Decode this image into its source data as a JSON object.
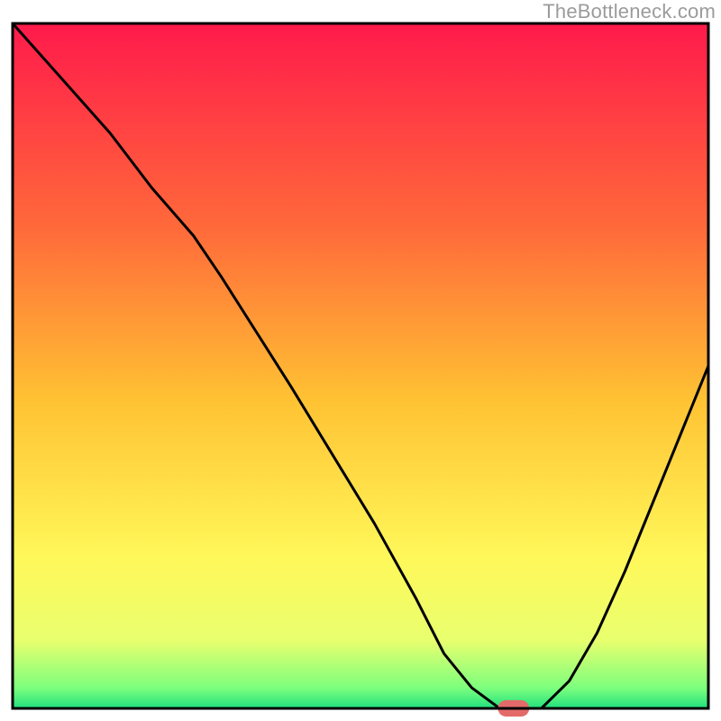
{
  "watermark": "TheBottleneck.com",
  "chart_data": {
    "type": "line",
    "title": "",
    "xlabel": "",
    "ylabel": "",
    "xlim": [
      0,
      100
    ],
    "ylim": [
      0,
      100
    ],
    "grid": false,
    "legend": false,
    "background_gradient": {
      "stops": [
        {
          "offset": 0.0,
          "color": "#ff1a4b"
        },
        {
          "offset": 0.3,
          "color": "#ff6a3a"
        },
        {
          "offset": 0.55,
          "color": "#ffc233"
        },
        {
          "offset": 0.78,
          "color": "#fff85a"
        },
        {
          "offset": 0.9,
          "color": "#e9ff6e"
        },
        {
          "offset": 0.97,
          "color": "#7dff7d"
        },
        {
          "offset": 1.0,
          "color": "#21e07f"
        }
      ]
    },
    "series": [
      {
        "name": "curve",
        "x": [
          0,
          7,
          14,
          20,
          26,
          30,
          35,
          40,
          46,
          52,
          58,
          62,
          66,
          70,
          73,
          76,
          80,
          84,
          88,
          92,
          96,
          100
        ],
        "y": [
          100,
          92,
          84,
          76,
          69,
          63,
          55,
          47,
          37,
          27,
          16,
          8,
          3,
          0,
          0,
          0,
          4,
          11,
          20,
          30,
          40,
          50
        ]
      }
    ],
    "annotations": [
      {
        "name": "marker",
        "shape": "rounded-rect",
        "cx": 72,
        "cy": 0,
        "w": 4.5,
        "h": 2.4,
        "fill": "#e46a6a"
      }
    ],
    "axes": {
      "frame_color": "#000000",
      "frame_width": 3
    }
  }
}
